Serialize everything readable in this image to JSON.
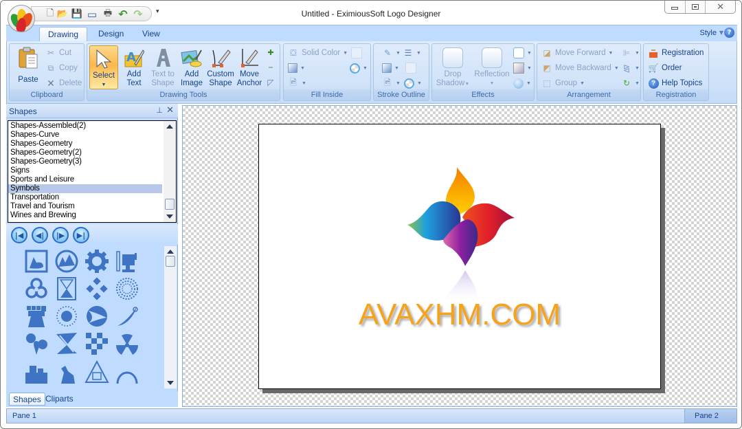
{
  "window": {
    "title": "Untitled - EximiousSoft Logo Designer",
    "controls": {
      "minimize": "minimize-icon",
      "maximize": "maximize-icon",
      "close": "close-icon"
    }
  },
  "quick_access": [
    {
      "name": "new-document-icon",
      "glyph": "🗋"
    },
    {
      "name": "open-folder-icon",
      "glyph": "📂"
    },
    {
      "name": "save-icon",
      "glyph": "💾"
    },
    {
      "name": "export-image-icon",
      "glyph": "▭"
    },
    {
      "name": "print-icon",
      "glyph": "🖶"
    },
    {
      "name": "undo-icon",
      "glyph": "↶"
    },
    {
      "name": "redo-icon",
      "glyph": "↷"
    }
  ],
  "qat_more": "▾",
  "ribbon": {
    "tabs": [
      {
        "label": "Drawing",
        "active": true
      },
      {
        "label": "Design",
        "active": false
      },
      {
        "label": "View",
        "active": false
      }
    ],
    "style_label": "Style",
    "help_glyph": "?",
    "groups": {
      "clipboard": {
        "label": "Clipboard",
        "paste": "Paste",
        "cut": "Cut",
        "copy": "Copy",
        "delete": "Delete"
      },
      "drawing_tools": {
        "label": "Drawing Tools",
        "select": "Select",
        "add_text": [
          "Add",
          "Text"
        ],
        "text_to_shape": [
          "Text to",
          "Shape"
        ],
        "add_image": [
          "Add",
          "Image"
        ],
        "custom_shape": [
          "Custom",
          "Shape"
        ],
        "move_anchor": [
          "Move",
          "Anchor"
        ]
      },
      "fill_inside": {
        "label": "Fill Inside",
        "solid_color": "Solid Color"
      },
      "stroke_outline": {
        "label": "Stroke Outline"
      },
      "effects": {
        "label": "Effects",
        "drop_shadow": [
          "Drop",
          "Shadow"
        ],
        "reflection": "Reflection"
      },
      "arrangement": {
        "label": "Arrangement",
        "move_forward": "Move Forward",
        "move_backward": "Move Backward",
        "group": "Group"
      },
      "registration": {
        "label": "Registration",
        "registration": "Registration",
        "order": "Order",
        "help_topics": "Help Topics"
      }
    }
  },
  "shapes_panel": {
    "title": "Shapes",
    "categories": [
      "Shapes-Assembled(2)",
      "Shapes-Curve",
      "Shapes-Geometry",
      "Shapes-Geometry(2)",
      "Shapes-Geometry(3)",
      "Signs",
      "Sports and Leisure",
      "Symbols",
      "Transportation",
      "Travel and Tourism",
      "Wines and Brewing"
    ],
    "selected_category": "Symbols",
    "nav_buttons": [
      "first-icon",
      "previous-icon",
      "next-icon",
      "last-icon"
    ],
    "gallery_icons": [
      "picture-frame-icon",
      "mountain-circle-icon",
      "gear-icon",
      "pencil-sharpener-icon",
      "biohazard-icon",
      "hourglass-icon",
      "diamond-cluster-icon",
      "dotted-circle-icon",
      "castle-tower-icon",
      "sun-icon",
      "swoosh-ball-icon",
      "sword-icon",
      "propeller-icon",
      "abstract-hourglass-icon",
      "checkerboard-icon",
      "radiation-icon",
      "city-icon",
      "figure-icon",
      "triangle-sign-icon",
      "arch-icon"
    ],
    "bottom_tabs": [
      {
        "label": "Shapes",
        "active": true
      },
      {
        "label": "Cliparts",
        "active": false
      }
    ]
  },
  "canvas": {
    "logo_text": "AVAXHM.COM",
    "logo_text_color": "#f7a21b",
    "petal_colors": {
      "top": [
        "#f57c00",
        "#ffd200"
      ],
      "right": [
        "#e53935",
        "#a3123e"
      ],
      "left": [
        "#8bc34a",
        "#1e88e5",
        "#283593"
      ],
      "bottom": [
        "#d04fa0",
        "#7b1fa2",
        "#3a2a8a"
      ]
    }
  },
  "statusbar": {
    "pane1": "Pane 1",
    "pane2": "Pane 2"
  }
}
